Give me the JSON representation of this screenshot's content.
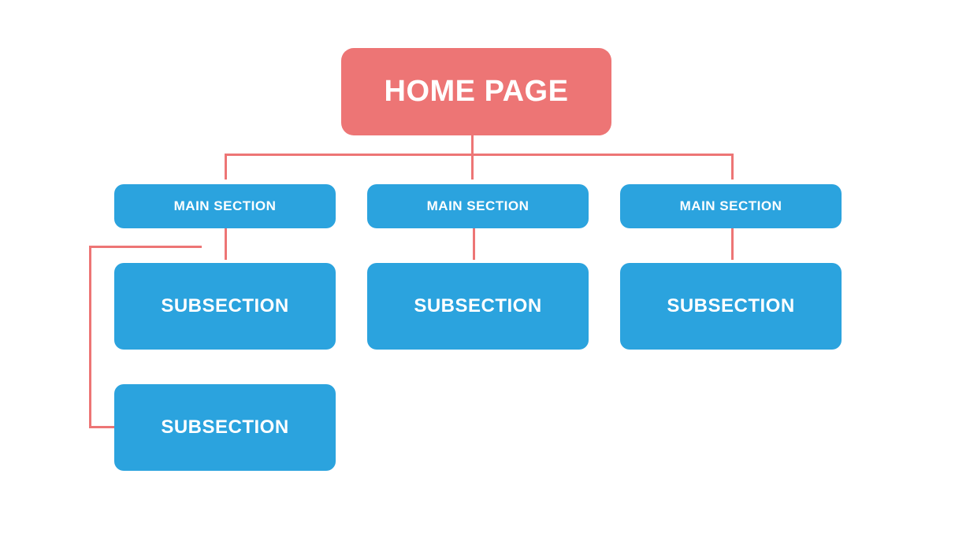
{
  "colors": {
    "root_bg": "#ED7575",
    "node_bg": "#2BA3DE",
    "connector": "#ED7575",
    "text": "#FFFFFF",
    "canvas_bg": "#FFFFFF"
  },
  "root": {
    "label": "HOME PAGE"
  },
  "mains": [
    {
      "label": "MAIN SECTION",
      "subs": [
        {
          "label": "SUBSECTION"
        },
        {
          "label": "SUBSECTION"
        }
      ]
    },
    {
      "label": "MAIN SECTION",
      "subs": [
        {
          "label": "SUBSECTION"
        }
      ]
    },
    {
      "label": "MAIN SECTION",
      "subs": [
        {
          "label": "SUBSECTION"
        }
      ]
    }
  ]
}
